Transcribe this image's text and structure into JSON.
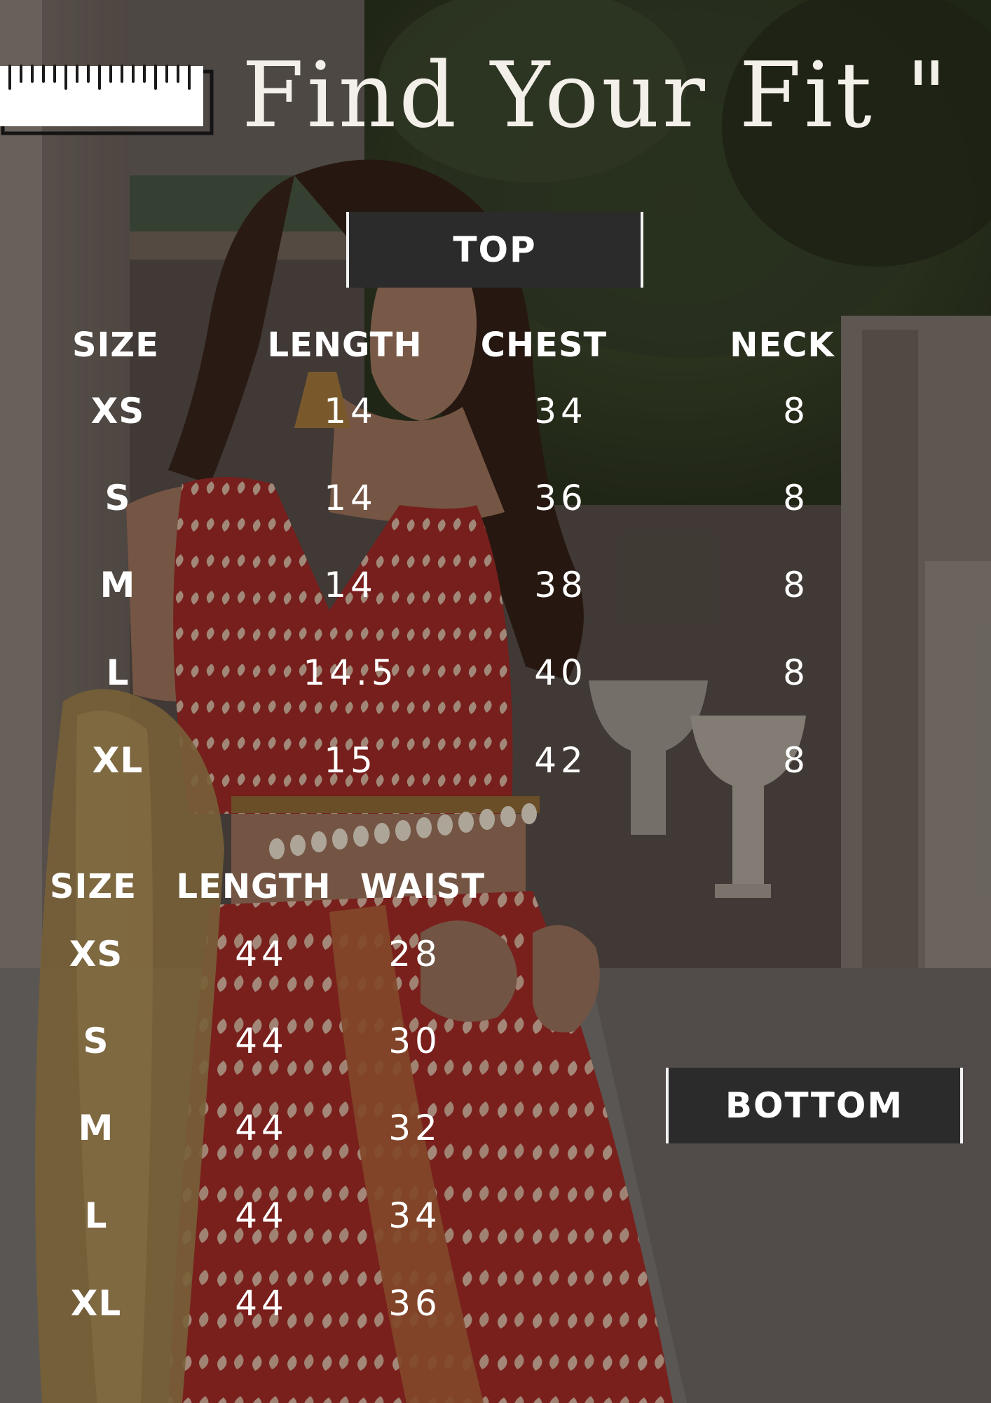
{
  "page": {
    "title": "Find Your Fit \""
  },
  "icons": {
    "ruler": "ruler-icon"
  },
  "top_table": {
    "label": "TOP",
    "headers": [
      "SIZE",
      "LENGTH",
      "CHEST",
      "NECK"
    ],
    "rows": [
      [
        "XS",
        "14",
        "34",
        "8"
      ],
      [
        "S",
        "14",
        "36",
        "8"
      ],
      [
        "M",
        "14",
        "38",
        "8"
      ],
      [
        "L",
        "14.5",
        "40",
        "8"
      ],
      [
        "XL",
        "15",
        "42",
        "8"
      ]
    ]
  },
  "bottom_table": {
    "label": "BOTTOM",
    "headers": [
      "SIZE",
      "LENGTH",
      "WAIST"
    ],
    "rows": [
      [
        "XS",
        "44",
        "28"
      ],
      [
        "S",
        "44",
        "30"
      ],
      [
        "M",
        "44",
        "32"
      ],
      [
        "L",
        "44",
        "34"
      ],
      [
        "XL",
        "44",
        "36"
      ]
    ]
  },
  "colors": {
    "text": "#ffffff",
    "label_background": "#2b2b2b",
    "label_border": "#f2f2f2",
    "dress_red": "#b32a27",
    "dupatta_gold": "#c9a35c"
  }
}
